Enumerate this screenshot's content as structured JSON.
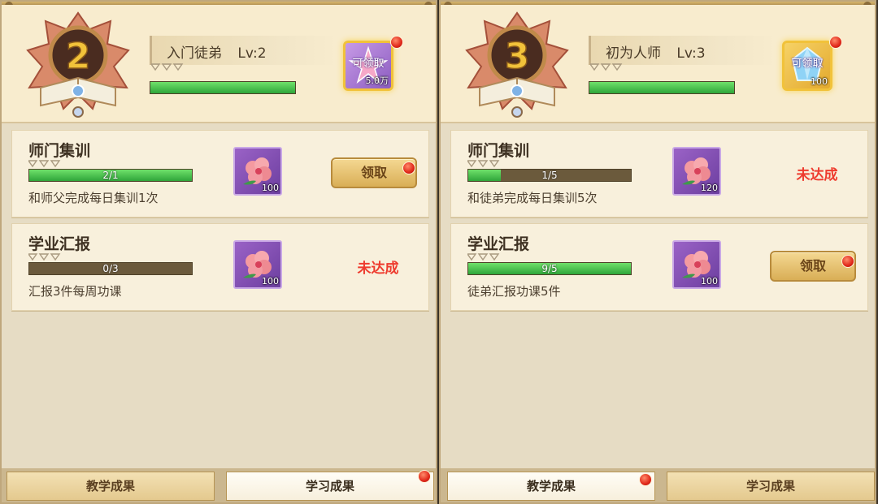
{
  "panels": [
    {
      "header": {
        "level_number": "2",
        "title": "入门徒弟",
        "level_label": "Lv:2",
        "level_progress": 1.0,
        "reward": {
          "label": "可领取",
          "count": "5.0万",
          "icon": "pink-star-icon",
          "has_notification": true
        }
      },
      "tasks": [
        {
          "title": "师门集训",
          "progress_text": "2/1",
          "progress": 1.0,
          "desc": "和师父完成每日集训1次",
          "item": {
            "icon": "flower-icon",
            "count": "100"
          },
          "status": "claim",
          "claim_label": "领取",
          "has_notification": true
        },
        {
          "title": "学业汇报",
          "progress_text": "0/3",
          "progress": 0.0,
          "desc": "汇报3件每周功课",
          "item": {
            "icon": "flower-icon",
            "count": "100"
          },
          "status": "incomplete",
          "status_label": "未达成"
        }
      ],
      "tabs": [
        {
          "label": "教学成果",
          "active": false,
          "has_notification": false
        },
        {
          "label": "学习成果",
          "active": true,
          "has_notification": true
        }
      ]
    },
    {
      "header": {
        "level_number": "3",
        "title": "初为人师",
        "level_label": "Lv:3",
        "level_progress": 1.0,
        "reward": {
          "label": "可领取",
          "count": "100",
          "icon": "blue-gem-icon",
          "has_notification": true
        }
      },
      "tasks": [
        {
          "title": "师门集训",
          "progress_text": "1/5",
          "progress": 0.2,
          "desc": "和徒弟完成每日集训5次",
          "item": {
            "icon": "flower-icon",
            "count": "120"
          },
          "status": "incomplete",
          "status_label": "未达成"
        },
        {
          "title": "学业汇报",
          "progress_text": "9/5",
          "progress": 1.0,
          "desc": "徒弟汇报功课5件",
          "item": {
            "icon": "flower-icon",
            "count": "100"
          },
          "status": "claim",
          "claim_label": "领取",
          "has_notification": true
        }
      ],
      "tabs": [
        {
          "label": "教学成果",
          "active": true,
          "has_notification": true
        },
        {
          "label": "学习成果",
          "active": false,
          "has_notification": false
        }
      ]
    }
  ],
  "colors": {
    "progress_fill": "#2fa63a",
    "progress_track": "#6b5a3c",
    "incomplete_text": "#ee3b2e",
    "notification_dot": "#e0281a",
    "reward_frame": "#f1c23a"
  }
}
